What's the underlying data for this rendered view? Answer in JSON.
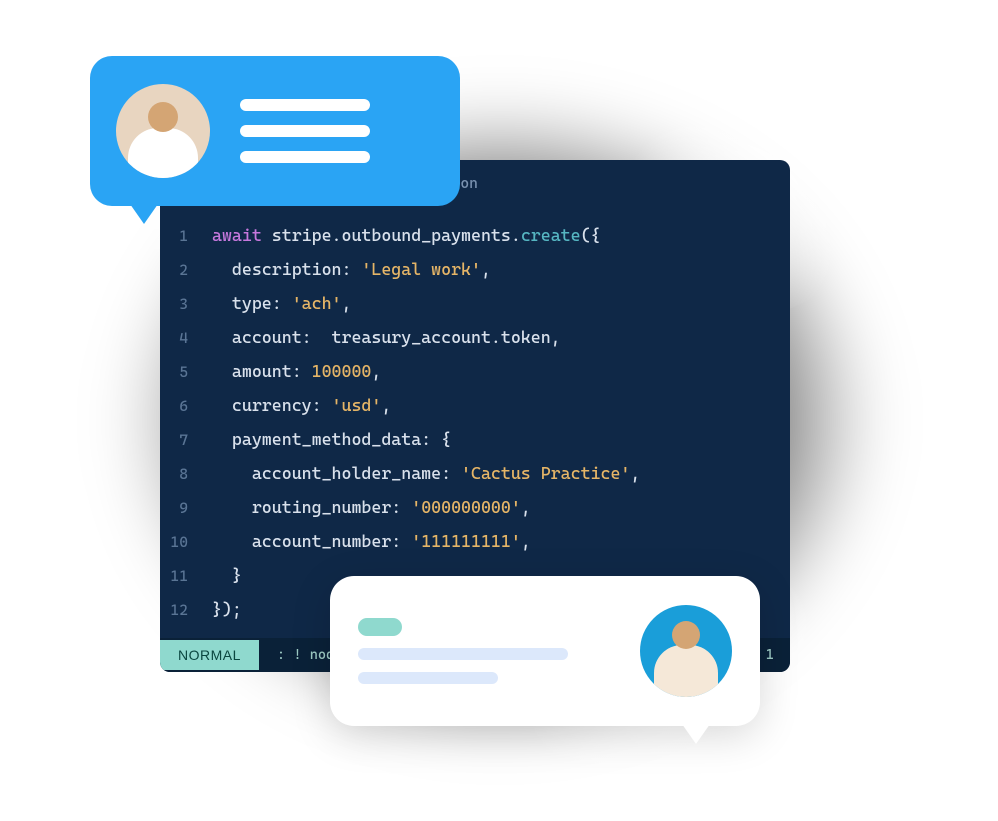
{
  "editor": {
    "tab_label": "…yton",
    "status": {
      "mode": "NORMAL",
      "command": ": ! node ach.js",
      "position": "n : 1"
    },
    "code": [
      {
        "n": 1,
        "tokens": [
          [
            "kw",
            "await"
          ],
          [
            "punc",
            " "
          ],
          [
            "id",
            "stripe.outbound_payments."
          ],
          [
            "meth",
            "create"
          ],
          [
            "punc",
            "({"
          ]
        ]
      },
      {
        "n": 2,
        "indent": "  ",
        "tokens": [
          [
            "id",
            "description:"
          ],
          [
            "punc",
            " "
          ],
          [
            "str",
            "'Legal work'"
          ],
          [
            "punc",
            ","
          ]
        ]
      },
      {
        "n": 3,
        "indent": "  ",
        "tokens": [
          [
            "id",
            "type:"
          ],
          [
            "punc",
            " "
          ],
          [
            "str",
            "'ach'"
          ],
          [
            "punc",
            ","
          ]
        ]
      },
      {
        "n": 4,
        "indent": "  ",
        "tokens": [
          [
            "id",
            "account:"
          ],
          [
            "punc",
            "  "
          ],
          [
            "id",
            "treasury_account.token"
          ],
          [
            "punc",
            ","
          ]
        ]
      },
      {
        "n": 5,
        "indent": "  ",
        "tokens": [
          [
            "id",
            "amount:"
          ],
          [
            "punc",
            " "
          ],
          [
            "num",
            "100000"
          ],
          [
            "punc",
            ","
          ]
        ]
      },
      {
        "n": 6,
        "indent": "  ",
        "tokens": [
          [
            "id",
            "currency:"
          ],
          [
            "punc",
            " "
          ],
          [
            "str",
            "'usd'"
          ],
          [
            "punc",
            ","
          ]
        ]
      },
      {
        "n": 7,
        "indent": "  ",
        "tokens": [
          [
            "id",
            "payment_method_data:"
          ],
          [
            "punc",
            " {"
          ]
        ]
      },
      {
        "n": 8,
        "indent": "    ",
        "tokens": [
          [
            "id",
            "account_holder_name:"
          ],
          [
            "punc",
            " "
          ],
          [
            "str",
            "'Cactus Practice'"
          ],
          [
            "punc",
            ","
          ]
        ]
      },
      {
        "n": 9,
        "indent": "    ",
        "tokens": [
          [
            "id",
            "routing_number:"
          ],
          [
            "punc",
            " "
          ],
          [
            "str",
            "'000000000'"
          ],
          [
            "punc",
            ","
          ]
        ]
      },
      {
        "n": 10,
        "indent": "    ",
        "tokens": [
          [
            "id",
            "account_number:"
          ],
          [
            "punc",
            " "
          ],
          [
            "str",
            "'111111111'"
          ],
          [
            "punc",
            ","
          ]
        ]
      },
      {
        "n": 11,
        "indent": "  ",
        "tokens": [
          [
            "punc",
            "}"
          ]
        ]
      },
      {
        "n": 12,
        "tokens": [
          [
            "punc",
            "});"
          ]
        ]
      }
    ]
  },
  "chat_blue": {
    "avatar_alt": "user-avatar-1"
  },
  "chat_white": {
    "avatar_alt": "user-avatar-2"
  }
}
